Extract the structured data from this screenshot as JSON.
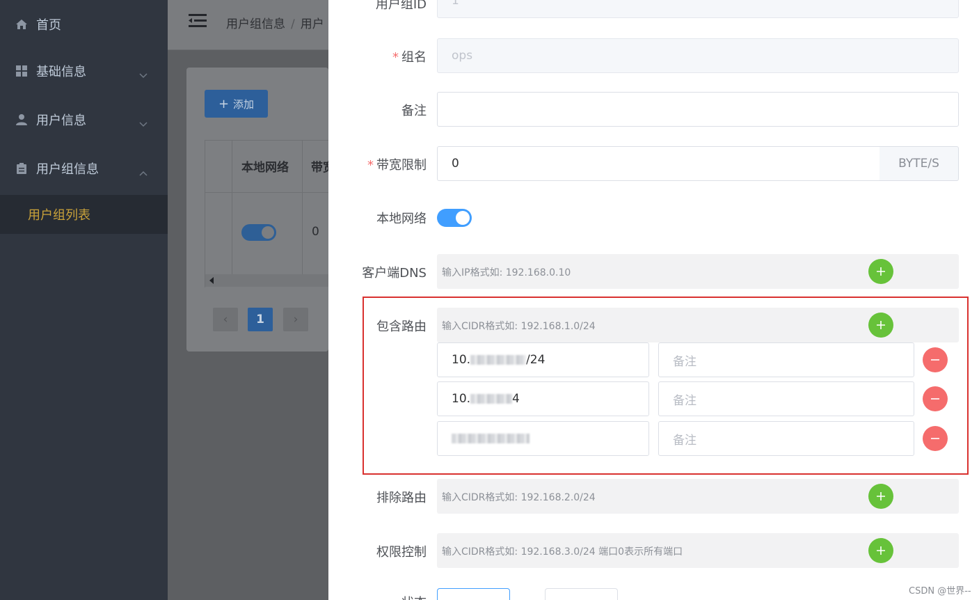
{
  "sidebar": {
    "items": [
      {
        "label": "首页",
        "icon": "home-icon"
      },
      {
        "label": "基础信息",
        "icon": "grid-icon"
      },
      {
        "label": "用户信息",
        "icon": "user-icon"
      },
      {
        "label": "用户组信息",
        "icon": "clipboard-icon"
      }
    ],
    "submenu_active": "用户组列表",
    "active_color": "#c9a23a"
  },
  "header": {
    "breadcrumb": [
      "用户组信息",
      "用户"
    ]
  },
  "list_page": {
    "add_label": "添加",
    "columns": [
      "本地网络",
      "带宽"
    ],
    "row": {
      "bandwidth": "0"
    },
    "pagination": {
      "current": "1",
      "prev": "‹",
      "next": "›"
    }
  },
  "form": {
    "fields": {
      "group_id": {
        "label": "用户组ID",
        "value": "1"
      },
      "group_name": {
        "label": "组名",
        "value": "ops"
      },
      "remark": {
        "label": "备注",
        "value": ""
      },
      "bandwidth": {
        "label": "带宽限制",
        "value": "0",
        "unit": "BYTE/S"
      },
      "local_network": {
        "label": "本地网络",
        "enabled": true
      },
      "client_dns": {
        "label": "客户端DNS",
        "placeholder": "输入IP格式如: 192.168.0.10"
      },
      "include_routes": {
        "label": "包含路由",
        "placeholder": "输入CIDR格式如: 192.168.1.0/24",
        "rows": [
          {
            "cidr_start": "10.",
            "cidr_end": "/24",
            "remark_placeholder": "备注"
          },
          {
            "cidr_start": "10.",
            "cidr_end": "4",
            "remark_placeholder": "备注"
          },
          {
            "cidr_start": "",
            "cidr_end": "",
            "remark_placeholder": "备注"
          }
        ]
      },
      "exclude_routes": {
        "label": "排除路由",
        "placeholder": "输入CIDR格式如: 192.168.2.0/24"
      },
      "permission": {
        "label": "权限控制",
        "placeholder": "输入CIDR格式如: 192.168.3.0/24 端口0表示所有端口"
      },
      "bottom_label": "状态"
    },
    "required_color": "#f56c6c",
    "switch_color": "#409eff",
    "plus_color": "#67c23a",
    "minus_color": "#f56c6c"
  },
  "watermark": "CSDN @世界--"
}
